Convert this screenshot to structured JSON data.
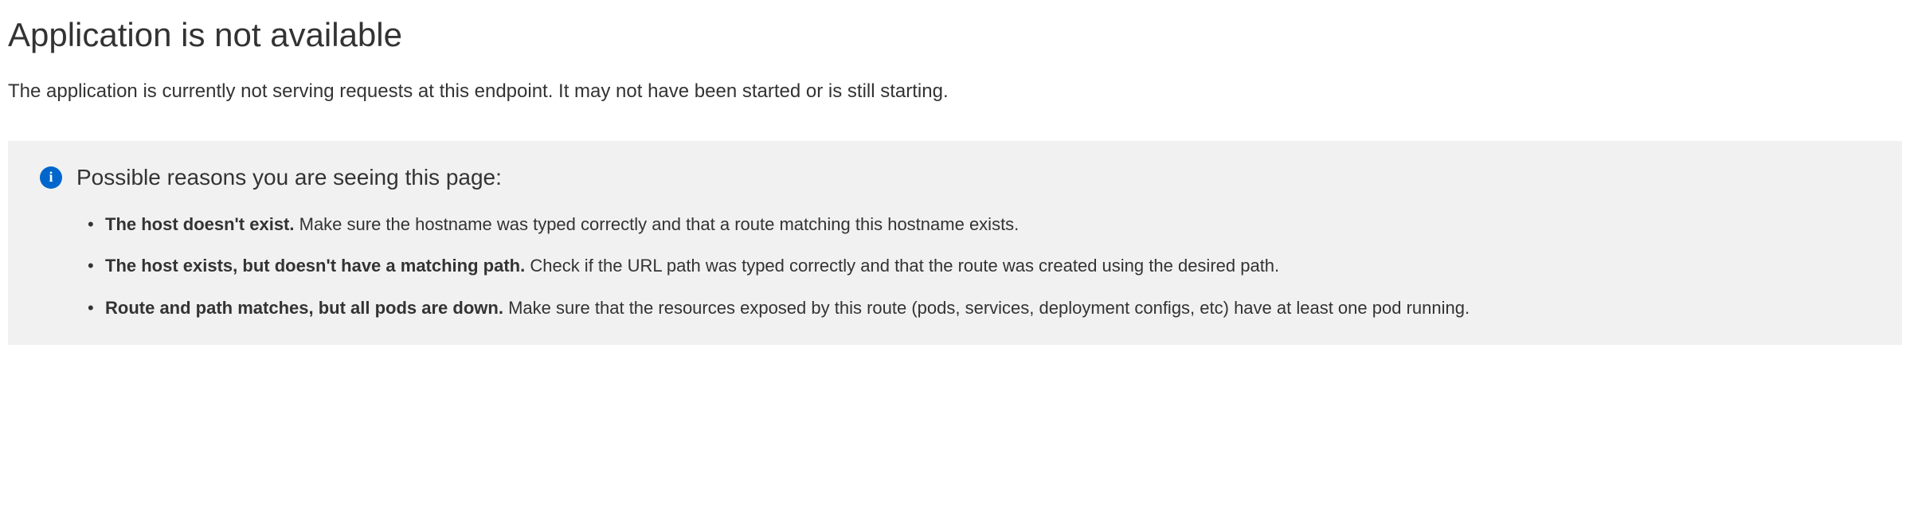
{
  "heading": "Application is not available",
  "description": "The application is currently not serving requests at this endpoint. It may not have been started or is still starting.",
  "info": {
    "icon": "i",
    "title": "Possible reasons you are seeing this page:",
    "reasons": [
      {
        "bold": "The host doesn't exist.",
        "text": " Make sure the hostname was typed correctly and that a route matching this hostname exists."
      },
      {
        "bold": "The host exists, but doesn't have a matching path.",
        "text": " Check if the URL path was typed correctly and that the route was created using the desired path."
      },
      {
        "bold": "Route and path matches, but all pods are down.",
        "text": " Make sure that the resources exposed by this route (pods, services, deployment configs, etc) have at least one pod running."
      }
    ]
  }
}
